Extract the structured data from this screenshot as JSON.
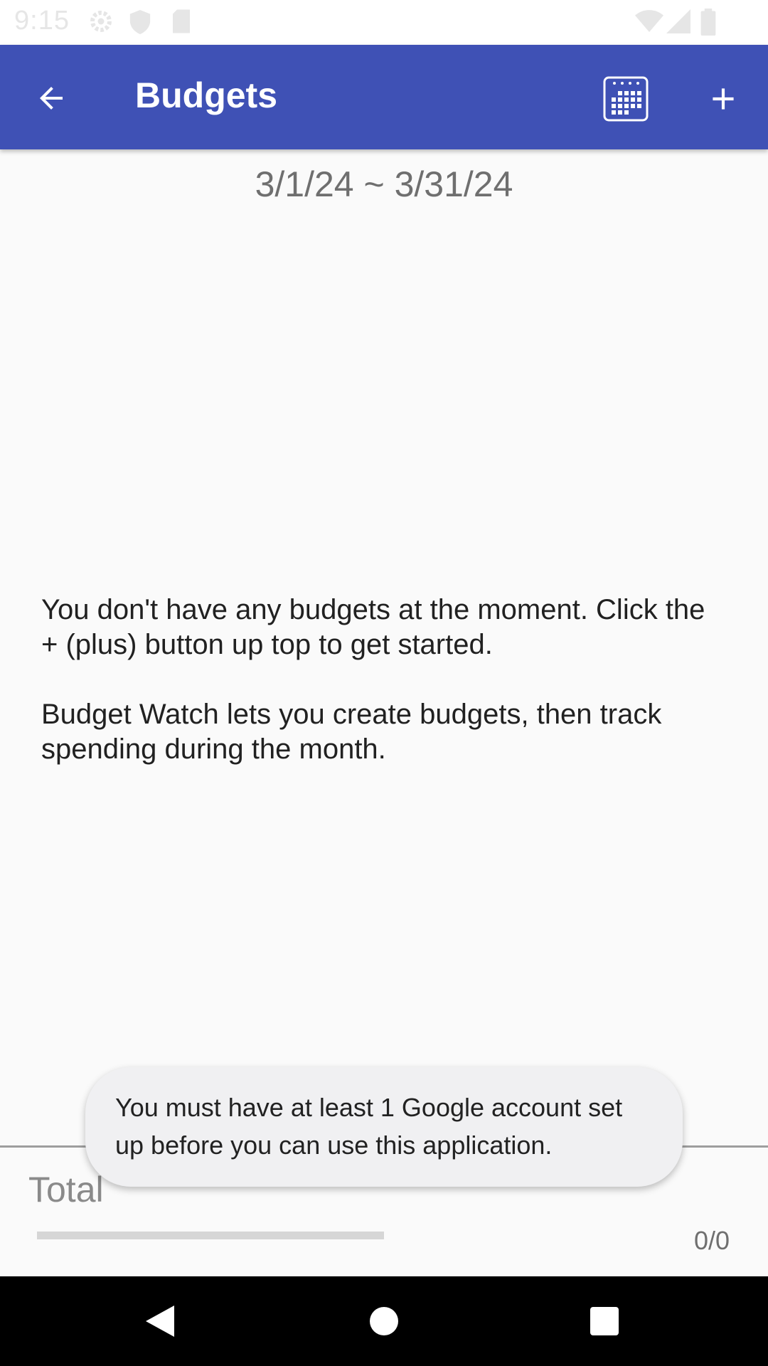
{
  "status_bar": {
    "time": "9:15",
    "icons": [
      "settings-icon",
      "shield-icon",
      "sd-card-icon",
      "wifi-icon",
      "signal-icon",
      "battery-icon"
    ]
  },
  "app_bar": {
    "title": "Budgets",
    "background_color": "#3f51b5",
    "icons": [
      "back-arrow-icon",
      "calendar-icon",
      "plus-icon"
    ]
  },
  "date_range": "3/1/24 ~ 3/31/24",
  "empty_state": {
    "line1": "You don't have any budgets at the moment. Click the + (plus) button up top to get started.",
    "line2": "Budget Watch lets you create budgets, then track spending during the month."
  },
  "total": {
    "label": "Total",
    "value": "0/0",
    "progress_fraction": 0
  },
  "toast": {
    "message": "You must have at least 1 Google account set up before you can use this application."
  },
  "nav_bar": {
    "icons": [
      "back-triangle-icon",
      "home-circle-icon",
      "recents-square-icon"
    ]
  }
}
